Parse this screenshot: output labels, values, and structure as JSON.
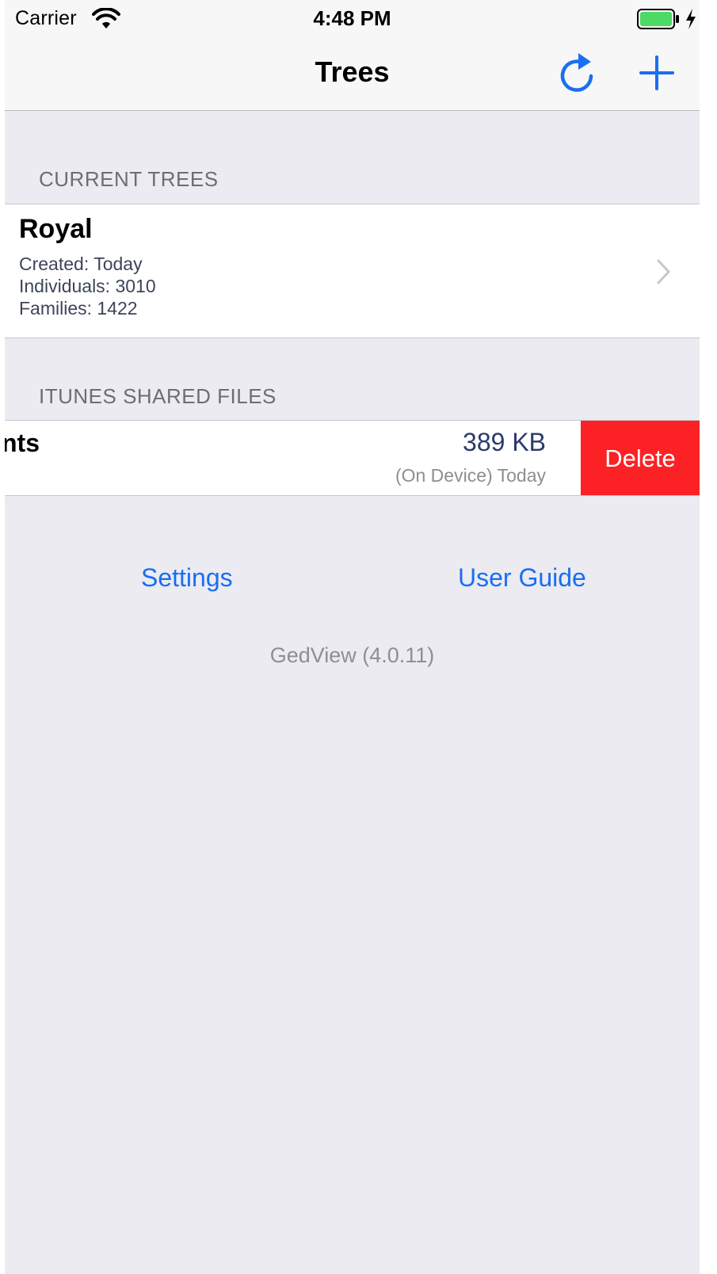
{
  "status_bar": {
    "carrier": "Carrier",
    "time": "4:48 PM",
    "battery_color": "#4cd964"
  },
  "nav": {
    "title": "Trees",
    "refresh_icon": "refresh-icon",
    "add_icon": "plus-icon",
    "tint_color": "#1a6ef2"
  },
  "sections": {
    "current_trees": {
      "header": "CURRENT TREES",
      "trees": [
        {
          "name": "Royal",
          "created": "Created: Today",
          "individuals": "Individuals: 3010",
          "families": "Families: 1422"
        }
      ]
    },
    "itunes_shared_files": {
      "header": "ITUNES SHARED FILES",
      "files": [
        {
          "name": "nts",
          "size": "389 KB",
          "meta": "(On Device) Today",
          "delete_label": "Delete",
          "delete_color": "#fc2125"
        }
      ]
    }
  },
  "footer": {
    "settings_label": "Settings",
    "user_guide_label": "User Guide",
    "version": "GedView (4.0.11)"
  }
}
